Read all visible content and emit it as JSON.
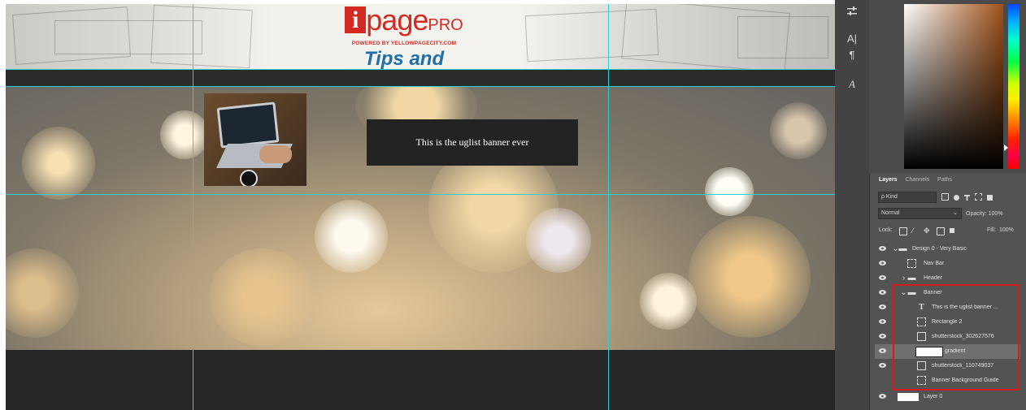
{
  "header": {
    "logo_mark": "i",
    "logo_word": "page",
    "logo_pro": "PRO",
    "logo_sub": "POWERED BY YELLOWPAGECITY.COM",
    "logo_tips": "Tips and Tricks"
  },
  "banner": {
    "text": "This is the uglist banner ever"
  },
  "toolstrip": {
    "icons": [
      "adjust-icon",
      "character-icon",
      "paragraph-icon",
      "glyphs-icon"
    ],
    "char_label": "A|",
    "para_label": "¶",
    "glyph_label": "A"
  },
  "layers_panel": {
    "tabs": [
      "Layers",
      "Channels",
      "Paths"
    ],
    "kind_label": "ρ Kind",
    "blend_mode": "Normal",
    "opacity_label": "Opacity:",
    "opacity_value": "100%",
    "lock_label": "Lock:",
    "fill_label": "Fill:",
    "fill_value": "100%",
    "layers": [
      {
        "name": "Design 0 - Very Basic",
        "type": "group"
      },
      {
        "name": "Nav Bar",
        "type": "artboard"
      },
      {
        "name": "Header",
        "type": "group"
      },
      {
        "name": "Banner",
        "type": "group"
      },
      {
        "name": "This is the uglist banner ...",
        "type": "text"
      },
      {
        "name": "Rectangle 2",
        "type": "shape"
      },
      {
        "name": "shutterstock_302627576",
        "type": "smart"
      },
      {
        "name": "gradient",
        "type": "gradient"
      },
      {
        "name": "shutterstock_110749037",
        "type": "smart"
      },
      {
        "name": "Banner Background Guide",
        "type": "shape"
      },
      {
        "name": "Layer 0",
        "type": "pixel"
      }
    ]
  },
  "colors": {
    "guide": "#27d1d8",
    "highlight_box": "#d31b1b",
    "logo_red": "#d42a22",
    "logo_blue": "#1f6fa8"
  }
}
